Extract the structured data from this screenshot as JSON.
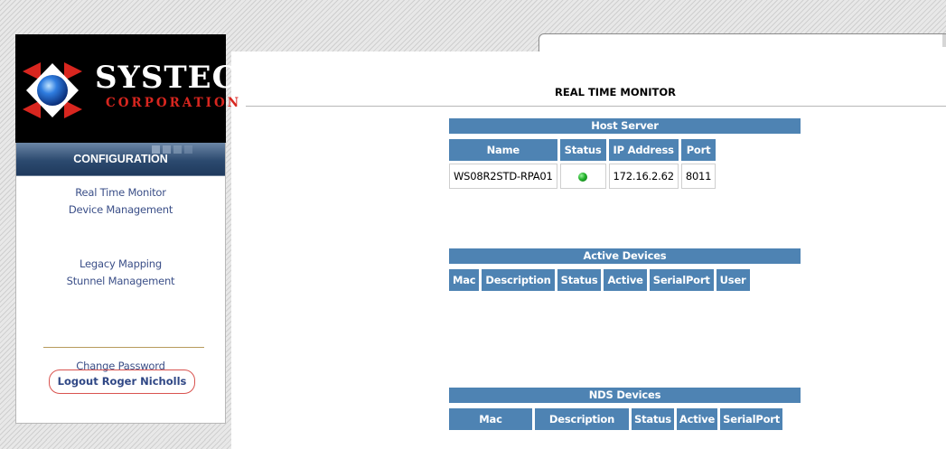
{
  "logo": {
    "name": "SYSTECH",
    "subtitle": "CORPORATION",
    "colors": {
      "red": "#d8261f",
      "blue": "#1a56b8",
      "background": "#000000"
    }
  },
  "sidebar": {
    "header": "CONFIGURATION",
    "links": [
      {
        "label": "Real Time Monitor"
      },
      {
        "label": "Device Management"
      },
      {
        "label": "Legacy Mapping"
      },
      {
        "label": "Stunnel Management"
      },
      {
        "label": "Change Password"
      }
    ],
    "logout_label": "Logout Roger Nicholls"
  },
  "page": {
    "title": "REAL TIME MONITOR"
  },
  "host_server": {
    "title": "Host Server",
    "columns": [
      "Name",
      "Status",
      "IP Address",
      "Port"
    ],
    "rows": [
      {
        "name": "WS08R2STD-RPA01",
        "status": "green-dot-icon",
        "ip": "172.16.2.62",
        "port": "8011"
      }
    ]
  },
  "active_devices": {
    "title": "Active Devices",
    "columns": [
      "Mac",
      "Description",
      "Status",
      "Active",
      "SerialPort",
      "User"
    ]
  },
  "nds_devices": {
    "title": "NDS Devices",
    "columns": [
      "Mac",
      "Description",
      "Status",
      "Active",
      "SerialPort"
    ]
  },
  "colors": {
    "header_blue": "#4e83b3",
    "link_color": "#3b4f88",
    "logout_border": "#d9534f",
    "status_green": "#22b22b"
  }
}
